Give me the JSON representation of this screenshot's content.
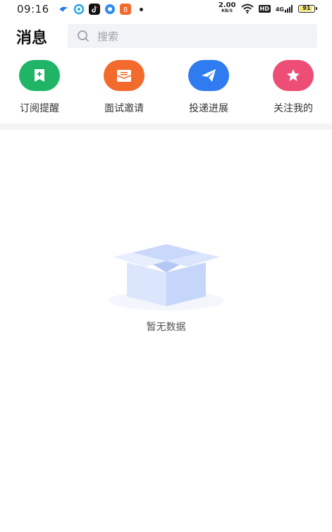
{
  "status_bar": {
    "time": "09:16",
    "net_speed_value": "2.00",
    "net_speed_unit": "KB/S",
    "hd": "HD",
    "signal": "4G",
    "battery_level": "91"
  },
  "header": {
    "title": "消息",
    "search_placeholder": "搜索"
  },
  "categories": [
    {
      "label": "订阅提醒",
      "color": "#1fb466",
      "icon": "bookmark-plus-icon"
    },
    {
      "label": "面试邀请",
      "color": "#f26b2d",
      "icon": "envelope-icon"
    },
    {
      "label": "投递进展",
      "color": "#2f7bf0",
      "icon": "paper-plane-icon"
    },
    {
      "label": "关注我的",
      "color": "#ee4d75",
      "icon": "star-icon"
    }
  ],
  "empty_state": {
    "text": "暂无数据",
    "icon": "empty-box-icon"
  }
}
